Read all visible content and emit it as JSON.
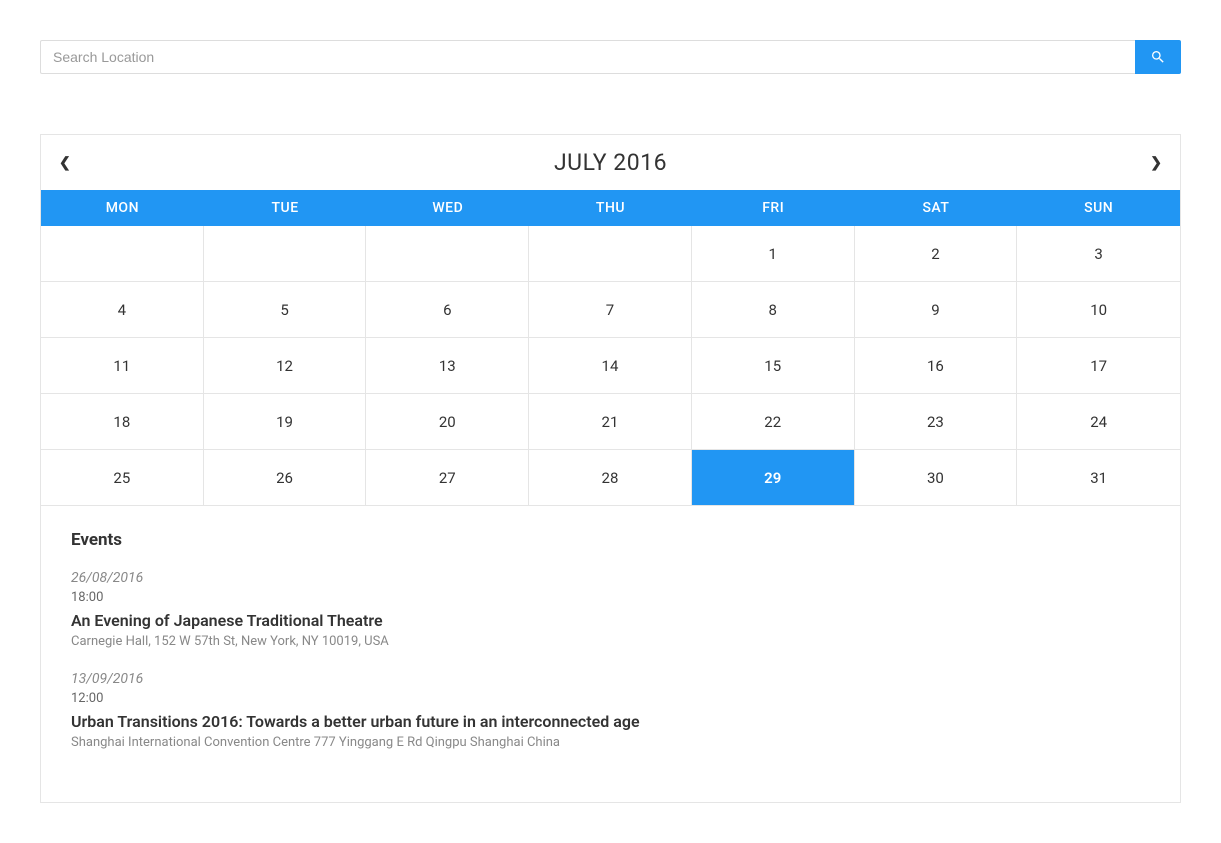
{
  "search": {
    "placeholder": "Search Location"
  },
  "calendar": {
    "title": "JULY 2016",
    "weekdays": [
      "MON",
      "TUE",
      "WED",
      "THU",
      "FRI",
      "SAT",
      "SUN"
    ],
    "leading_empty": 4,
    "days": [
      1,
      2,
      3,
      4,
      5,
      6,
      7,
      8,
      9,
      10,
      11,
      12,
      13,
      14,
      15,
      16,
      17,
      18,
      19,
      20,
      21,
      22,
      23,
      24,
      25,
      26,
      27,
      28,
      29,
      30,
      31
    ],
    "selected_day": 29
  },
  "events": {
    "heading": "Events",
    "items": [
      {
        "date": "26/08/2016",
        "time": "18:00",
        "title": "An Evening of Japanese Traditional Theatre",
        "location": "Carnegie Hall, 152 W 57th St, New York, NY 10019, USA"
      },
      {
        "date": "13/09/2016",
        "time": "12:00",
        "title": "Urban Transitions 2016: Towards a better urban future in an interconnected age",
        "location": "Shanghai International Convention Centre 777 Yinggang E Rd Qingpu Shanghai China"
      }
    ]
  }
}
